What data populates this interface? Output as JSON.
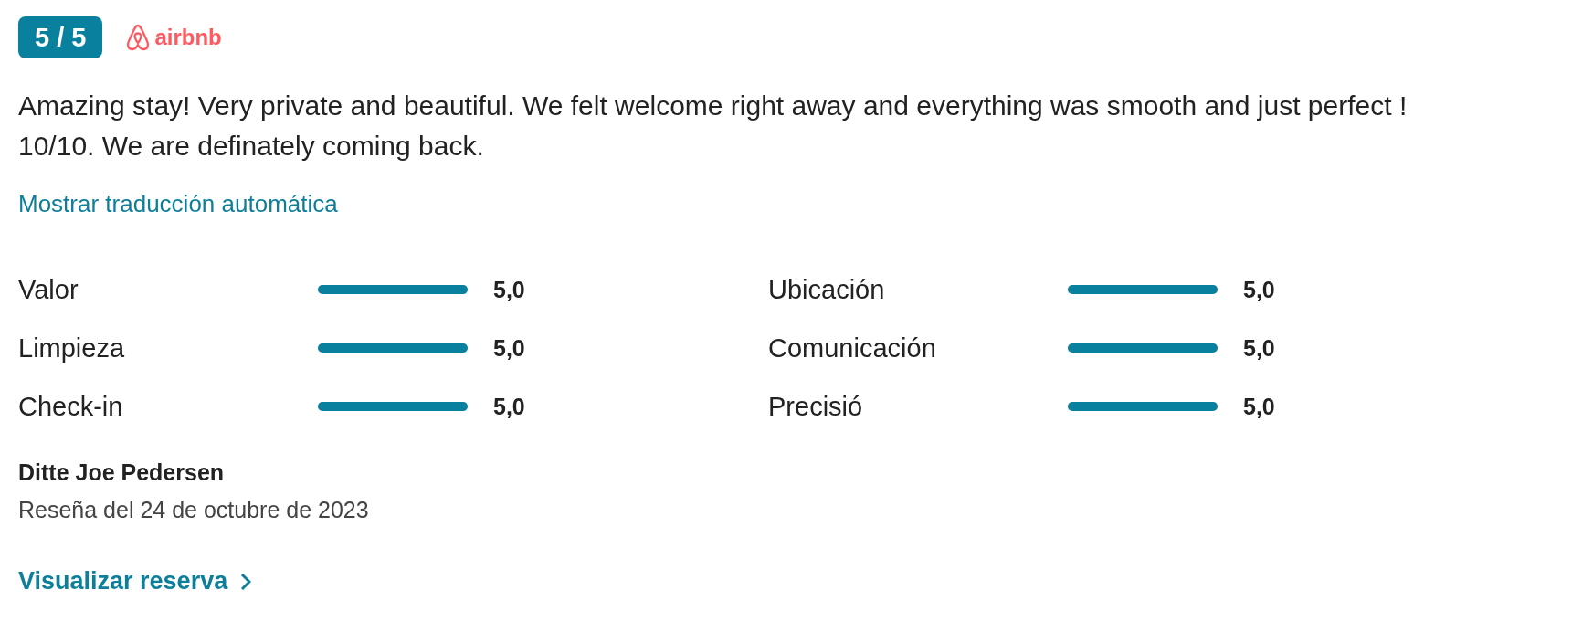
{
  "score_badge": "5 / 5",
  "source": {
    "name": "airbnb"
  },
  "review_text": "Amazing stay! Very private and beautiful. We felt welcome right away and everything was smooth and just perfect ! 10/10. We are definately coming back.",
  "translate_link": "Mostrar traducción automática",
  "ratings": [
    {
      "label": "Valor",
      "level": 1,
      "value": "5,0"
    },
    {
      "label": "Ubicación",
      "level": 1,
      "value": "5,0"
    },
    {
      "label": "Limpieza",
      "level": 1,
      "value": "5,0"
    },
    {
      "label": "Comunicación",
      "level": 1,
      "value": "5,0"
    },
    {
      "label": "Check-in",
      "level": 1,
      "value": "5,0"
    },
    {
      "label": "Precisió",
      "level": 1,
      "value": "5,0"
    }
  ],
  "reviewer": "Ditte Joe Pedersen",
  "review_date": "Reseña del 24 de octubre de 2023",
  "booking_link": "Visualizar reserva"
}
